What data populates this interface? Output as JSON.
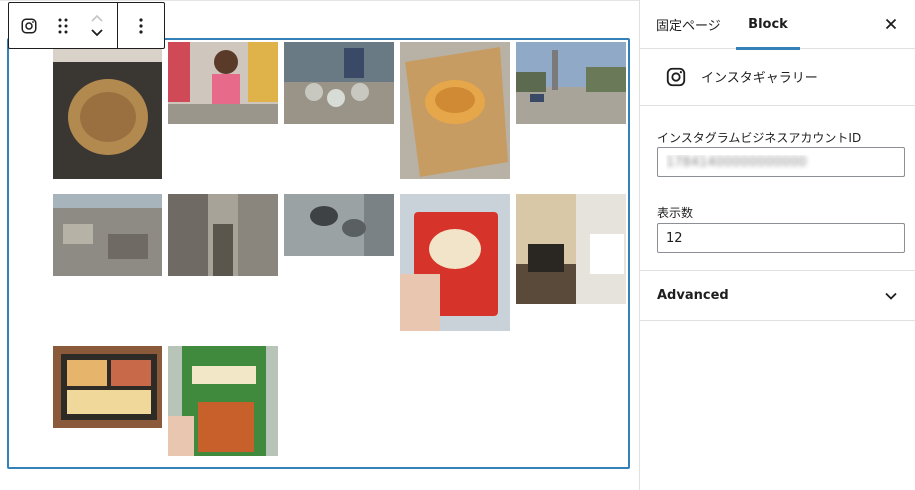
{
  "toolbar": {
    "block_icon": "instagram-icon",
    "drag_icon": "drag-handle-icon",
    "move_up_icon": "chevron-up-icon",
    "move_down_icon": "chevron-down-icon",
    "more_icon": "more-vertical-icon"
  },
  "gallery": {
    "images": [
      {
        "subject": "okonomiyaki-pan",
        "colors": [
          "#3a3632",
          "#b28a50"
        ]
      },
      {
        "subject": "children-street",
        "colors": [
          "#cf4a56",
          "#e0b24a"
        ]
      },
      {
        "subject": "crowd-water-jugs",
        "colors": [
          "#6a7a84",
          "#c8c8c0"
        ]
      },
      {
        "subject": "pastry-on-paper",
        "colors": [
          "#c79c62",
          "#e6a64a"
        ]
      },
      {
        "subject": "damaged-street",
        "colors": [
          "#8fa9c6",
          "#5c6a50"
        ]
      },
      {
        "subject": "debris-field",
        "colors": [
          "#8e8a84",
          "#b6b2a6"
        ]
      },
      {
        "subject": "cemetery-tombs",
        "colors": [
          "#6f6a64",
          "#a7a399"
        ]
      },
      {
        "subject": "motorbikes-alley",
        "colors": [
          "#9aa2a4",
          "#5a6062"
        ]
      },
      {
        "subject": "ebisen-snack-bag",
        "colors": [
          "#d6342a",
          "#f1e4c8"
        ]
      },
      {
        "subject": "drip-coffee",
        "colors": [
          "#5a4a3a",
          "#d8c8a8"
        ]
      },
      {
        "subject": "bento-box",
        "colors": [
          "#2e2a26",
          "#e6b46a"
        ]
      },
      {
        "subject": "wasabi-snack-bag",
        "colors": [
          "#3f8a3c",
          "#c8602c"
        ]
      }
    ]
  },
  "sidebar": {
    "tabs": {
      "page": "固定ページ",
      "block": "Block"
    },
    "close_icon": "close-icon",
    "block_card": {
      "icon": "instagram-icon",
      "title": "インスタギャラリー"
    },
    "fields": {
      "account_id": {
        "label": "インスタグラムビジネスアカウントID",
        "value": "17841400000000000"
      },
      "display_count": {
        "label": "表示数",
        "value": "12"
      }
    },
    "advanced": {
      "label": "Advanced",
      "icon": "chevron-down-icon"
    }
  },
  "colors": {
    "accent": "#3381b8",
    "border": "#1e1e1e",
    "divider": "#e0e0e0"
  }
}
